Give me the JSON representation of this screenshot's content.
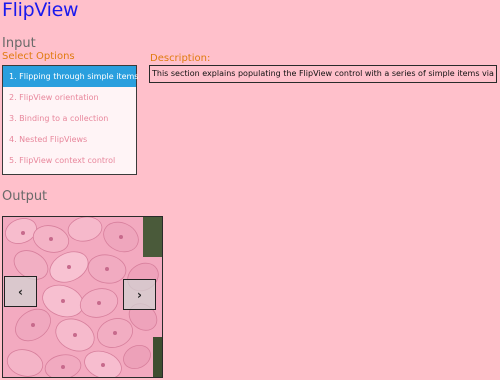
{
  "app": {
    "title": "FlipView"
  },
  "input": {
    "heading": "Input",
    "select_label": "Select Options",
    "options": [
      {
        "label": "1. Flipping through simple items",
        "selected": true
      },
      {
        "label": "2. FlipView orientation",
        "selected": false
      },
      {
        "label": "3. Binding to a collection",
        "selected": false
      },
      {
        "label": "4. Nested FlipViews",
        "selected": false
      },
      {
        "label": "5. FlipView context control",
        "selected": false
      }
    ],
    "description_label": "Description:",
    "description_text": "This section explains populating the FlipView control with a series of simple items via XAML"
  },
  "output": {
    "heading": "Output",
    "flipview": {
      "image_subject": "pink hydrangea flowers",
      "prev_icon": "chevron-left-icon",
      "next_icon": "chevron-right-icon",
      "prev_glyph": "‹",
      "next_glyph": "›"
    }
  },
  "colors": {
    "background": "#ffc0cb",
    "title": "#1a1aee",
    "accent_label": "#e07b10",
    "selected_item": "#2a9fde",
    "item_text": "#e8879c"
  }
}
